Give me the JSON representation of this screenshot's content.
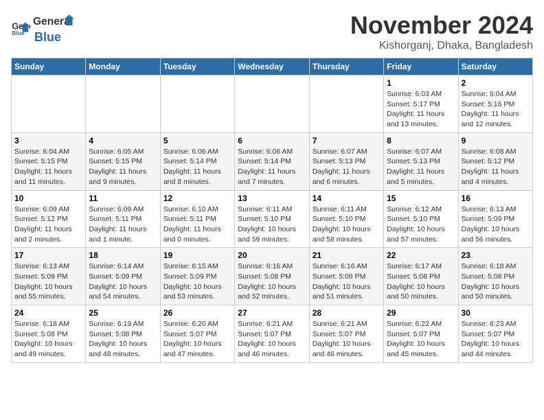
{
  "header": {
    "logo_general": "General",
    "logo_blue": "Blue",
    "title": "November 2024",
    "subtitle": "Kishorganj, Dhaka, Bangladesh"
  },
  "weekdays": [
    "Sunday",
    "Monday",
    "Tuesday",
    "Wednesday",
    "Thursday",
    "Friday",
    "Saturday"
  ],
  "weeks": [
    [
      {
        "day": "",
        "info": ""
      },
      {
        "day": "",
        "info": ""
      },
      {
        "day": "",
        "info": ""
      },
      {
        "day": "",
        "info": ""
      },
      {
        "day": "",
        "info": ""
      },
      {
        "day": "1",
        "info": "Sunrise: 6:03 AM\nSunset: 5:17 PM\nDaylight: 11 hours and 13 minutes."
      },
      {
        "day": "2",
        "info": "Sunrise: 6:04 AM\nSunset: 5:16 PM\nDaylight: 11 hours and 12 minutes."
      }
    ],
    [
      {
        "day": "3",
        "info": "Sunrise: 6:04 AM\nSunset: 5:15 PM\nDaylight: 11 hours and 11 minutes."
      },
      {
        "day": "4",
        "info": "Sunrise: 6:05 AM\nSunset: 5:15 PM\nDaylight: 11 hours and 9 minutes."
      },
      {
        "day": "5",
        "info": "Sunrise: 6:06 AM\nSunset: 5:14 PM\nDaylight: 11 hours and 8 minutes."
      },
      {
        "day": "6",
        "info": "Sunrise: 6:06 AM\nSunset: 5:14 PM\nDaylight: 11 hours and 7 minutes."
      },
      {
        "day": "7",
        "info": "Sunrise: 6:07 AM\nSunset: 5:13 PM\nDaylight: 11 hours and 6 minutes."
      },
      {
        "day": "8",
        "info": "Sunrise: 6:07 AM\nSunset: 5:13 PM\nDaylight: 11 hours and 5 minutes."
      },
      {
        "day": "9",
        "info": "Sunrise: 6:08 AM\nSunset: 5:12 PM\nDaylight: 11 hours and 4 minutes."
      }
    ],
    [
      {
        "day": "10",
        "info": "Sunrise: 6:09 AM\nSunset: 5:12 PM\nDaylight: 11 hours and 2 minutes."
      },
      {
        "day": "11",
        "info": "Sunrise: 6:09 AM\nSunset: 5:11 PM\nDaylight: 11 hours and 1 minute."
      },
      {
        "day": "12",
        "info": "Sunrise: 6:10 AM\nSunset: 5:11 PM\nDaylight: 11 hours and 0 minutes."
      },
      {
        "day": "13",
        "info": "Sunrise: 6:11 AM\nSunset: 5:10 PM\nDaylight: 10 hours and 59 minutes."
      },
      {
        "day": "14",
        "info": "Sunrise: 6:11 AM\nSunset: 5:10 PM\nDaylight: 10 hours and 58 minutes."
      },
      {
        "day": "15",
        "info": "Sunrise: 6:12 AM\nSunset: 5:10 PM\nDaylight: 10 hours and 57 minutes."
      },
      {
        "day": "16",
        "info": "Sunrise: 6:13 AM\nSunset: 5:09 PM\nDaylight: 10 hours and 56 minutes."
      }
    ],
    [
      {
        "day": "17",
        "info": "Sunrise: 6:13 AM\nSunset: 5:09 PM\nDaylight: 10 hours and 55 minutes."
      },
      {
        "day": "18",
        "info": "Sunrise: 6:14 AM\nSunset: 5:09 PM\nDaylight: 10 hours and 54 minutes."
      },
      {
        "day": "19",
        "info": "Sunrise: 6:15 AM\nSunset: 5:09 PM\nDaylight: 10 hours and 53 minutes."
      },
      {
        "day": "20",
        "info": "Sunrise: 6:16 AM\nSunset: 5:08 PM\nDaylight: 10 hours and 52 minutes."
      },
      {
        "day": "21",
        "info": "Sunrise: 6:16 AM\nSunset: 5:08 PM\nDaylight: 10 hours and 51 minutes."
      },
      {
        "day": "22",
        "info": "Sunrise: 6:17 AM\nSunset: 5:08 PM\nDaylight: 10 hours and 50 minutes."
      },
      {
        "day": "23",
        "info": "Sunrise: 6:18 AM\nSunset: 5:08 PM\nDaylight: 10 hours and 50 minutes."
      }
    ],
    [
      {
        "day": "24",
        "info": "Sunrise: 6:18 AM\nSunset: 5:08 PM\nDaylight: 10 hours and 49 minutes."
      },
      {
        "day": "25",
        "info": "Sunrise: 6:19 AM\nSunset: 5:08 PM\nDaylight: 10 hours and 48 minutes."
      },
      {
        "day": "26",
        "info": "Sunrise: 6:20 AM\nSunset: 5:07 PM\nDaylight: 10 hours and 47 minutes."
      },
      {
        "day": "27",
        "info": "Sunrise: 6:21 AM\nSunset: 5:07 PM\nDaylight: 10 hours and 46 minutes."
      },
      {
        "day": "28",
        "info": "Sunrise: 6:21 AM\nSunset: 5:07 PM\nDaylight: 10 hours and 46 minutes."
      },
      {
        "day": "29",
        "info": "Sunrise: 6:22 AM\nSunset: 5:07 PM\nDaylight: 10 hours and 45 minutes."
      },
      {
        "day": "30",
        "info": "Sunrise: 6:23 AM\nSunset: 5:07 PM\nDaylight: 10 hours and 44 minutes."
      }
    ]
  ]
}
